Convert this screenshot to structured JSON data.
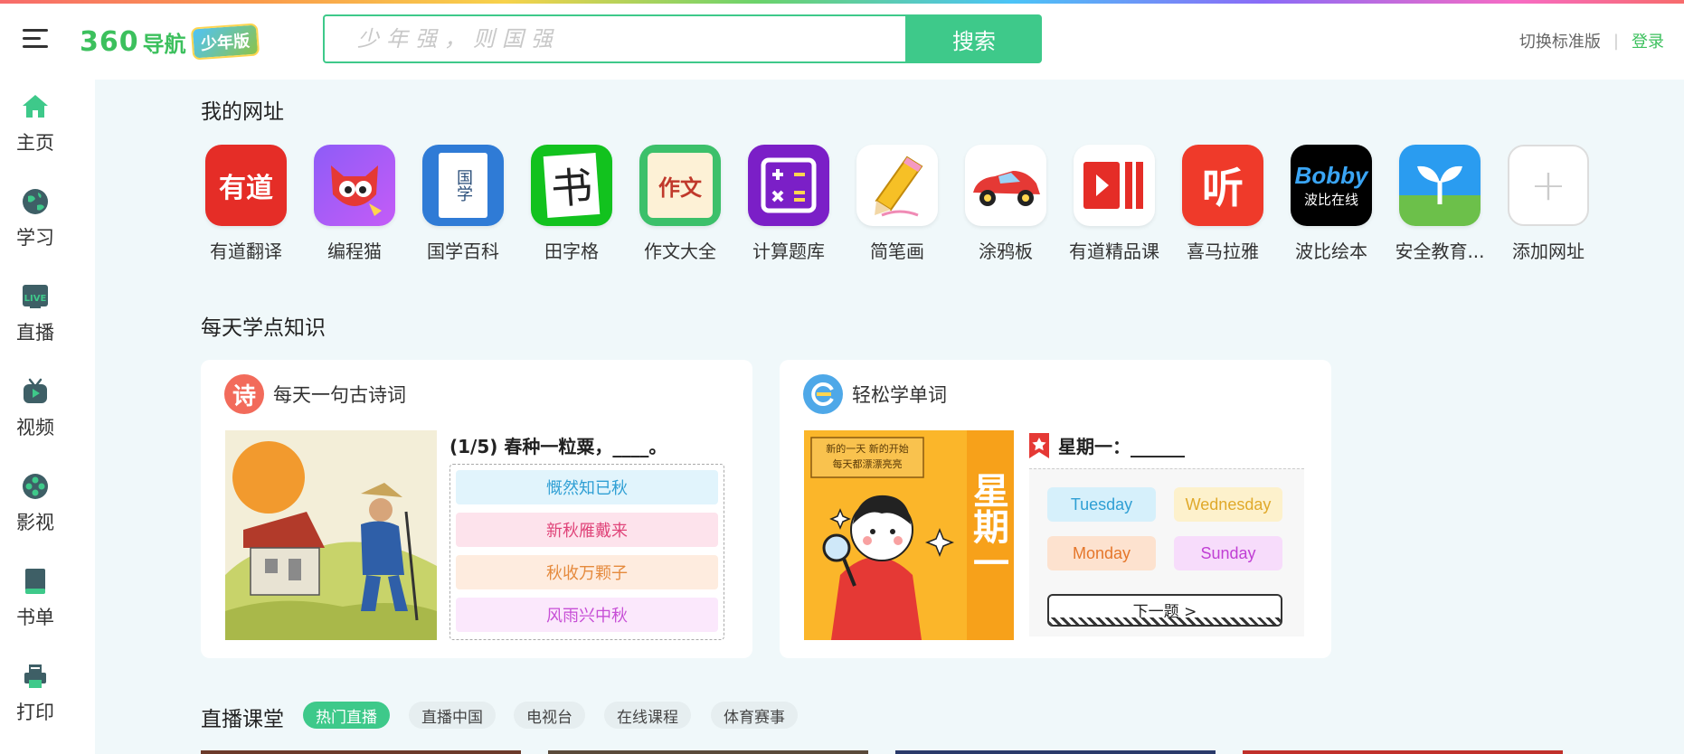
{
  "header": {
    "logo_360": "360",
    "logo_nav": "导航",
    "logo_kid": "少年版",
    "search_placeholder": "少年强，则国强",
    "search_button": "搜索",
    "switch_label": "切换标准版",
    "divider": "|",
    "login_label": "登录"
  },
  "sidebar": {
    "items": [
      {
        "label": "主页",
        "icon": "home-icon"
      },
      {
        "label": "学习",
        "icon": "globe-icon"
      },
      {
        "label": "直播",
        "icon": "live-icon"
      },
      {
        "label": "视频",
        "icon": "tv-icon"
      },
      {
        "label": "影视",
        "icon": "film-icon"
      },
      {
        "label": "书单",
        "icon": "book-icon"
      },
      {
        "label": "打印",
        "icon": "printer-icon"
      }
    ]
  },
  "my_sites": {
    "title": "我的网址",
    "items": [
      {
        "label": "有道翻译",
        "icon_text": "有道"
      },
      {
        "label": "编程猫",
        "icon_text": ""
      },
      {
        "label": "国学百科",
        "icon_text": "国学"
      },
      {
        "label": "田字格",
        "icon_text": "书"
      },
      {
        "label": "作文大全",
        "icon_text": "作文"
      },
      {
        "label": "计算题库",
        "icon_text": ""
      },
      {
        "label": "简笔画",
        "icon_text": ""
      },
      {
        "label": "涂鸦板",
        "icon_text": ""
      },
      {
        "label": "有道精品课",
        "icon_text": ""
      },
      {
        "label": "喜马拉雅",
        "icon_text": "听"
      },
      {
        "label": "波比绘本",
        "icon_text": "波比在线"
      },
      {
        "label": "安全教育...",
        "icon_text": ""
      },
      {
        "label": "添加网址",
        "icon_text": "+"
      }
    ]
  },
  "daily": {
    "title": "每天学点知识",
    "poem": {
      "badge": "诗",
      "title": "每天一句古诗词",
      "question": "(1/5) 春种一粒粟，____。",
      "options": [
        "慨然知已秋",
        "新秋雁戴来",
        "秋收万颗子",
        "风雨兴中秋"
      ]
    },
    "words": {
      "title": "轻松学单词",
      "banner_line1": "新的一天 新的开始",
      "banner_line2": "每天都漂漂亮亮",
      "banner_big": "星期一",
      "question": "星期一：______",
      "options": [
        "Tuesday",
        "Wednesday",
        "Monday",
        "Sunday"
      ],
      "next": "下一题 >"
    }
  },
  "live": {
    "title": "直播课堂",
    "tabs": [
      "热门直播",
      "直播中国",
      "电视台",
      "在线课程",
      "体育赛事"
    ]
  },
  "colors": {
    "accent": "#3ec98a",
    "login": "#3cc05d"
  }
}
